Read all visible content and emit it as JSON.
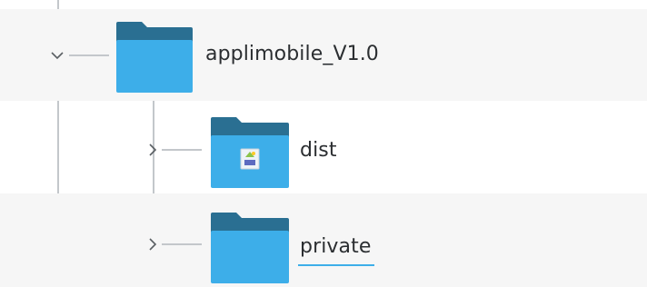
{
  "colors": {
    "folder_front": "#3daee9",
    "folder_back": "#2a6f92",
    "alt_row_background": "#f6f6f6",
    "tree_guide": "#c3c7cb",
    "text": "#2b2e31",
    "rename_underline": "#3daee9"
  },
  "tree": {
    "items": [
      {
        "label": "applimobile_V1.0",
        "expanded": true,
        "twisty_icon": "chevron-down-icon",
        "folder_icon": "folder-icon"
      },
      {
        "label": "dist",
        "expanded": false,
        "twisty_icon": "chevron-right-icon",
        "folder_icon": "folder-icon",
        "emblem_icon": "image-file-emblem-icon"
      },
      {
        "label": "private",
        "expanded": false,
        "twisty_icon": "chevron-right-icon",
        "folder_icon": "folder-icon",
        "editing": true
      }
    ]
  }
}
